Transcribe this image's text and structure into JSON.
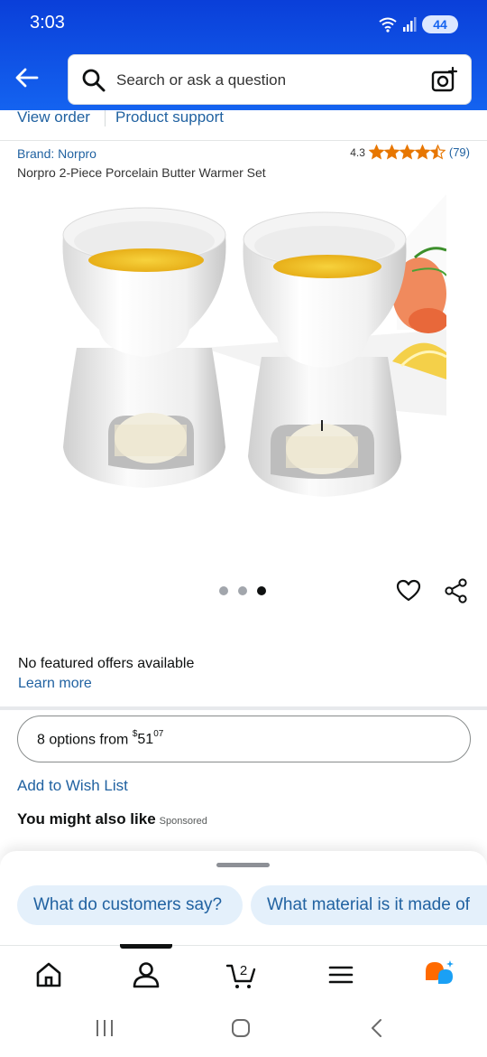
{
  "status_bar": {
    "time": "3:03",
    "battery": "44"
  },
  "search": {
    "placeholder": "Search or ask a question"
  },
  "links": {
    "view_order": "View order",
    "product_support": "Product support"
  },
  "product": {
    "brand": "Brand: Norpro",
    "rating": "4.3",
    "stars": 4.5,
    "review_count": "(79)",
    "title": "Norpro 2-Piece Porcelain Butter Warmer Set"
  },
  "carousel": {
    "dot_count": 3,
    "active_index": 2
  },
  "offers": {
    "no_offers": "No featured offers available",
    "learn_more": "Learn more",
    "options_prefix": "8 options from ",
    "price_currency": "$",
    "price_whole": "51",
    "price_fraction": "07"
  },
  "wishlist": {
    "label": "Add to Wish List"
  },
  "recommendations": {
    "heading": "You might also like",
    "sponsored": "Sponsored"
  },
  "chips": [
    "What do customers say?",
    "What material is it made of"
  ],
  "bottom_nav": {
    "items": [
      "home-icon",
      "account-icon",
      "cart-icon",
      "menu-icon",
      "rufus-icon"
    ],
    "cart_count": "2"
  },
  "colors": {
    "header_blue": "#1463f0",
    "link_blue": "#2162a1",
    "star_orange": "#e77600",
    "chip_bg": "#e4f0fb",
    "rufus_orange": "#ff6a00",
    "rufus_blue": "#1aa0f5"
  }
}
